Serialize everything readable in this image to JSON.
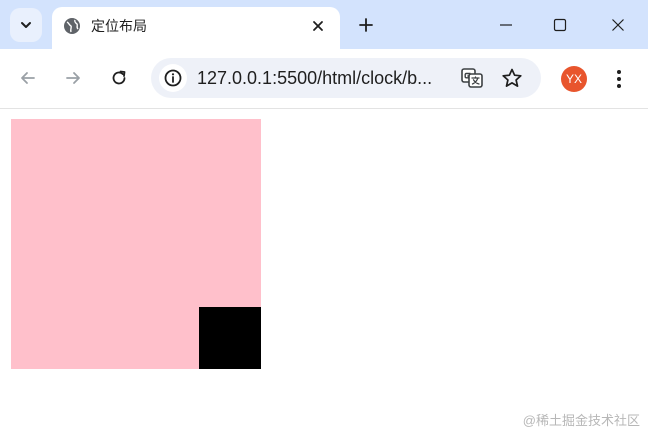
{
  "tab": {
    "title": "定位布局"
  },
  "toolbar": {
    "url": "127.0.0.1:5500/html/clock/b...",
    "avatar_initials": "YX"
  },
  "watermark": "@稀土掘金技术社区",
  "colors": {
    "tabstrip": "#d3e3fd",
    "omnibox": "#eef1f8",
    "avatar": "#e8552d",
    "pink_box": "#ffc0cb",
    "black_box": "#000000"
  },
  "icons": {
    "tab_search": "chevron-down-icon",
    "favicon": "globe-icon",
    "tab_close": "close-icon",
    "new_tab": "plus-icon",
    "minimize": "minimize-icon",
    "maximize": "maximize-icon",
    "window_close": "close-icon",
    "back": "arrow-left-icon",
    "forward": "arrow-right-icon",
    "reload": "reload-icon",
    "site_info": "info-icon",
    "translate": "translate-icon",
    "bookmark": "star-icon",
    "menu": "kebab-menu-icon"
  }
}
